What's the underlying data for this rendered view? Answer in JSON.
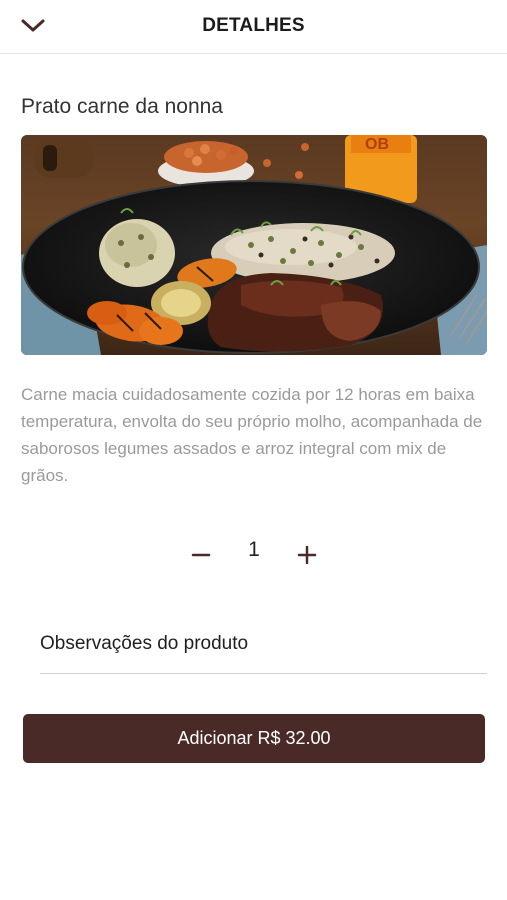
{
  "header": {
    "title": "DETALHES",
    "back_icon": "chevron-down-icon"
  },
  "product": {
    "name": "Prato carne da nonna",
    "image_alt": "Prato carne da nonna",
    "description": "Carne macia cuidadosamente cozida por 12 horas em baixa temperatura, envolta do seu próprio molho, acompanhada de saborosos legumes assados e arroz integral com mix de grãos."
  },
  "quantity": {
    "value": "1",
    "minus_label": "−",
    "plus_label": "+"
  },
  "observations": {
    "placeholder": "Observações do produto",
    "value": ""
  },
  "add_button": {
    "label": "Adicionar R$ 32.00"
  },
  "colors": {
    "accent": "#4a2a26",
    "description_text": "#9a9a9a",
    "divider": "#e4e4e4"
  }
}
